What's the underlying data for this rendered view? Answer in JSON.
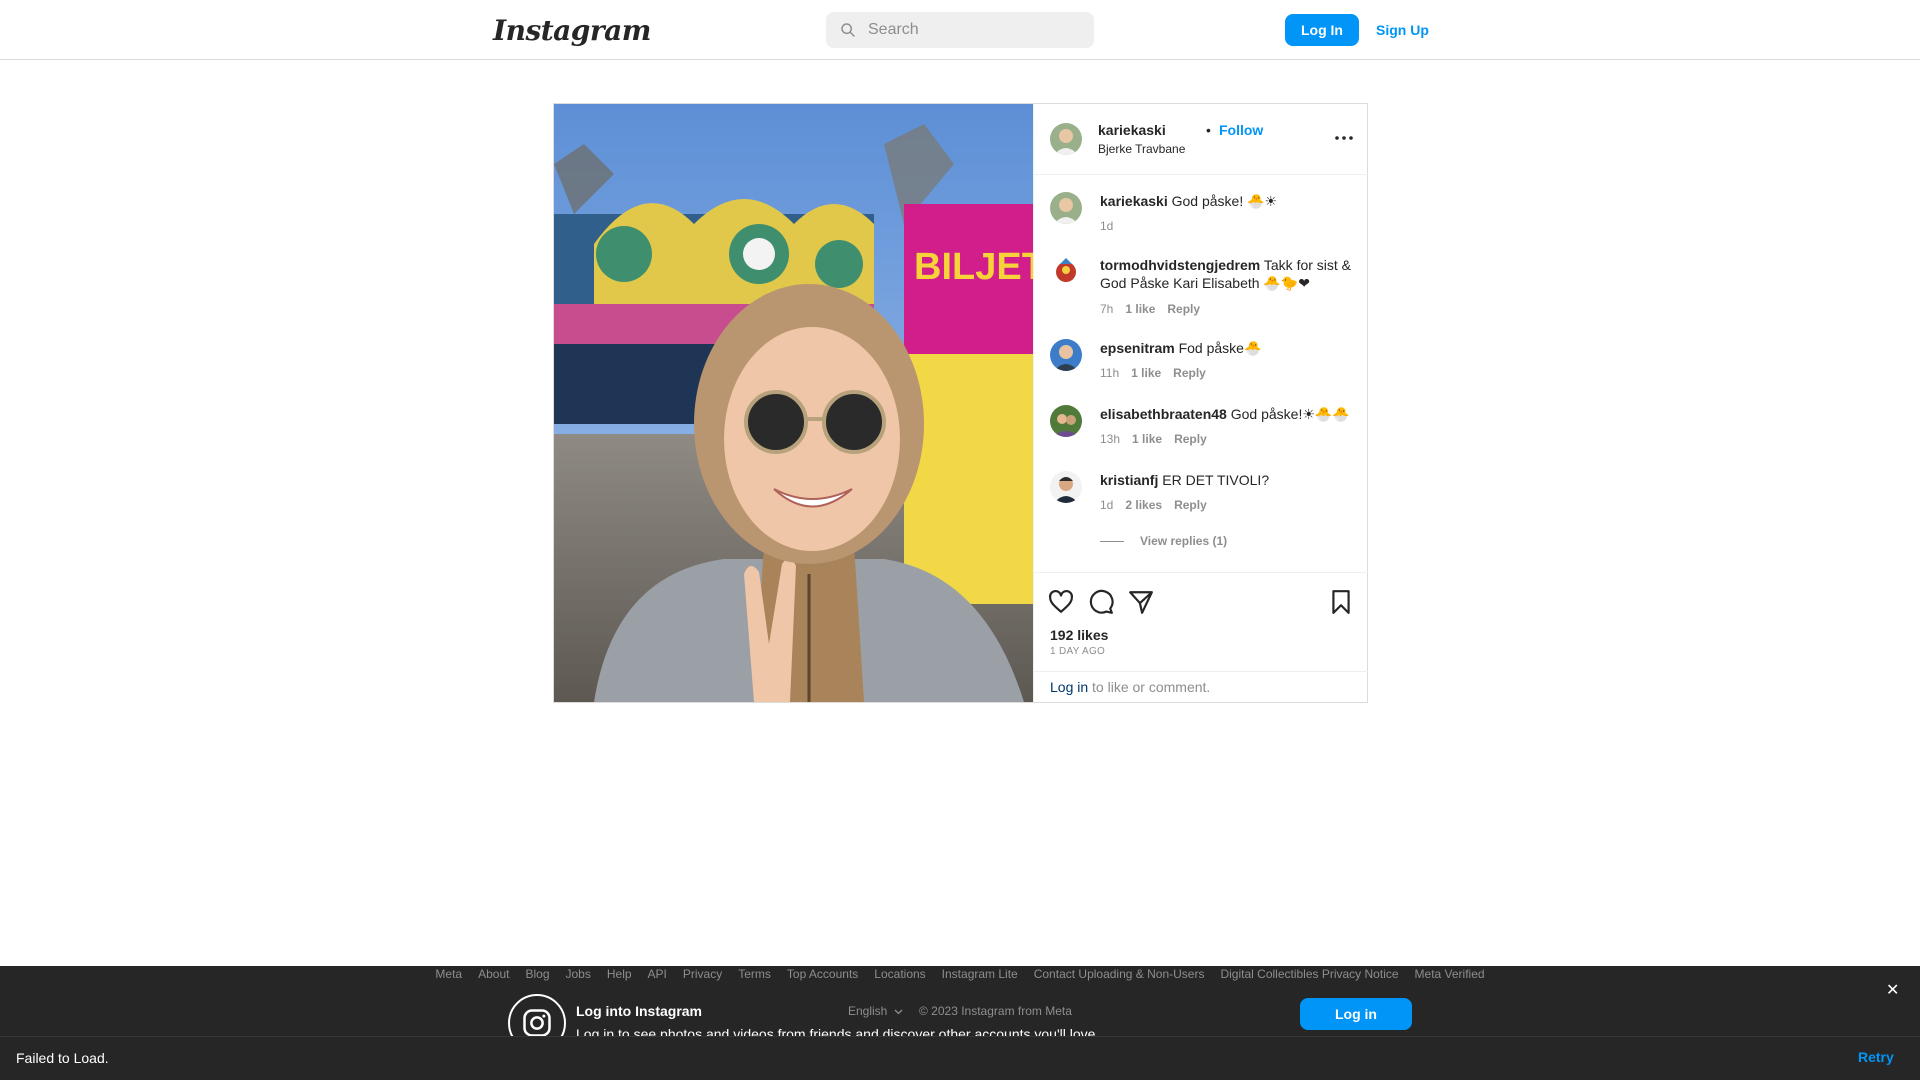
{
  "header": {
    "logo": "Instagram",
    "search_placeholder": "Search",
    "login_label": "Log In",
    "signup_label": "Sign Up"
  },
  "post": {
    "username": "kariekaski",
    "separator": "•",
    "follow_label": "Follow",
    "location": "Bjerke Travbane",
    "likes": "192 likes",
    "time_ago": "1 DAY AGO",
    "login_link": "Log in",
    "login_suffix": " to like or comment."
  },
  "comments": [
    {
      "user": "kariekaski",
      "text": "God påske! 🐣☀",
      "time": "1d",
      "likes": "",
      "reply": ""
    },
    {
      "user": "tormodhvidstengjedrem",
      "text": "Takk for sist & God Påske Kari Elisabeth 🐣🐤❤",
      "time": "7h",
      "likes": "1 like",
      "reply": "Reply"
    },
    {
      "user": "epsenitram",
      "text": "Fod påske🐣",
      "time": "11h",
      "likes": "1 like",
      "reply": "Reply"
    },
    {
      "user": "elisabethbraaten48",
      "text": "God påske!☀🐣🐣",
      "time": "13h",
      "likes": "1 like",
      "reply": "Reply"
    },
    {
      "user": "kristianfj",
      "text": "ER DET TIVOLI?",
      "time": "1d",
      "likes": "2 likes",
      "reply": "Reply"
    }
  ],
  "view_replies": "View replies (1)",
  "footer": {
    "links": [
      "Meta",
      "About",
      "Blog",
      "Jobs",
      "Help",
      "API",
      "Privacy",
      "Terms",
      "Top Accounts",
      "Locations",
      "Instagram Lite",
      "Contact Uploading & Non-Users",
      "Digital Collectibles Privacy Notice",
      "Meta Verified"
    ],
    "title": "Log into Instagram",
    "subtitle": "Log in to see photos and videos from friends and discover other accounts you'll love.",
    "language": "English",
    "copyright": "© 2023 Instagram from Meta",
    "login_label": "Log in",
    "close": "✕"
  },
  "error_bar": {
    "message": "Failed to Load.",
    "retry_label": "Retry"
  },
  "colors": {
    "accent": "#0095f6",
    "footer_bg": "#262626",
    "border": "#dbdbdb"
  },
  "icons": [
    "search-icon",
    "more-icon",
    "heart-icon",
    "comment-icon",
    "share-icon",
    "bookmark-icon",
    "instagram-icon",
    "close-icon",
    "chevron-down-icon"
  ]
}
